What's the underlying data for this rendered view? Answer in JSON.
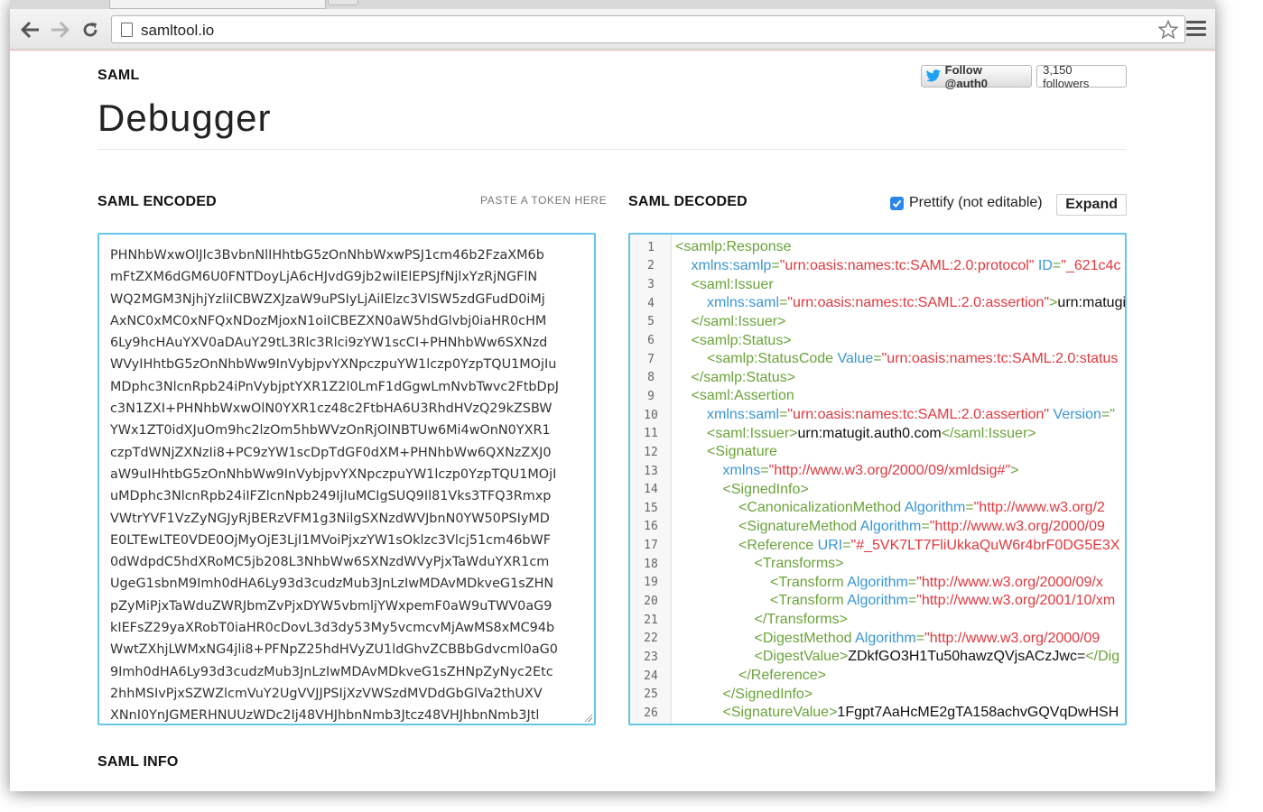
{
  "browser": {
    "url": "samltool.io"
  },
  "header": {
    "brand": "SAML",
    "title": "Debugger",
    "follow_label": "Follow @auth0",
    "followers": "3,150 followers"
  },
  "encoded": {
    "label": "SAML ENCODED",
    "hint": "PASTE A TOKEN HERE",
    "lines": [
      "PHNhbWxwOlJlc3BvbnNlIHhtbG5zOnNhbWxwPSJ1cm46b2FzaXM6b",
      "mFtZXM6dGM6U0FNTDoyLjA6cHJvdG9jb2wiIElEPSJfNjlxYzRjNGFlN",
      "WQ2MGM3NjhjYzliICBWZXJzaW9uPSIyLjAiIElzc3VlSW5zdGFudD0iMj",
      "AxNC0xMC0xNFQxNDozMjoxN1oiICBEZXN0aW5hdGlvbj0iaHR0cHM",
      "6Ly9hcHAuYXV0aDAuY29tL3Rlc3Rlci9zYW1scCI+PHNhbWw6SXNzd",
      "WVyIHhtbG5zOnNhbWw9InVybjpvYXNpczpuYW1lczp0YzpTQU1MOjIu",
      "MDphc3NlcnRpb24iPnVybjptYXR1Z2l0LmF1dGgwLmNvbTwvc2FtbDpJ",
      "c3N1ZXI+PHNhbWxwOlN0YXR1cz48c2FtbHA6U3RhdHVzQ29kZSBW",
      "YWx1ZT0idXJuOm9hc2lzOm5hbWVzOnRjOlNBTUw6Mi4wOnN0YXR1",
      "czpTdWNjZXNzIi8+PC9zYW1scDpTdGF0dXM+PHNhbWw6QXNzZXJ0",
      "aW9uIHhtbG5zOnNhbWw9InVybjpvYXNpczpuYW1lczp0YzpTQU1MOjI",
      "uMDphc3NlcnRpb24iIFZlcnNpb249IjIuMCIgSUQ9Il81Vks3TFQ3Rmxp",
      "VWtrYVF1VzZyNGJyRjBERzVFM1g3NilgSXNzdWVJbnN0YW50PSIyMD",
      "E0LTEwLTE0VDE0OjMyOjE3LjI1MVoiPjxzYW1sOklzc3Vlcj51cm46bWF",
      "0dWdpdC5hdXRoMC5jb208L3NhbWw6SXNzdWVyPjxTaWduYXR1cm",
      "UgeG1sbnM9Imh0dHA6Ly93d3cudzMub3JnLzIwMDAvMDkveG1sZHN",
      "pZyMiPjxTaWduZWRJbmZvPjxDYW5vbmljYWxpemF0aW9uTWV0aG9",
      "kIEFsZ29yaXRobT0iaHR0cDovL3d3dy53My5vcmcvMjAwMS8xMC94b",
      "WwtZXhjLWMxNG4jli8+PFNpZ25hdHVyZU1ldGhvZCBBbGdvcml0aG0",
      "9Imh0dHA6Ly93d3cudzMub3JnLzIwMDAvMDkveG1sZHNpZyNyc2Etc",
      "2hhMSIvPjxSZWZlcmVuY2UgVVJJPSIjXzVWSzdMVDdGbGlVa2thUXV",
      "XNnI0YnJGMERHNUUzWDc2Ij48VHJhbnNmb3Jtcz48VHJhbnNmb3Jtl"
    ]
  },
  "decoded": {
    "label": "SAML DECODED",
    "prettify_label": "Prettify (not editable)",
    "prettify_checked": true,
    "expand_label": "Expand",
    "lines": [
      {
        "n": "1",
        "indent": 0,
        "parts": [
          [
            "tag",
            "<samlp:Response"
          ]
        ]
      },
      {
        "n": "2",
        "indent": 1,
        "parts": [
          [
            "attr",
            "xmlns:samlp"
          ],
          [
            "tag",
            "="
          ],
          [
            "val",
            "\"urn:oasis:names:tc:SAML:2.0:protocol\""
          ],
          [
            "attr",
            " ID"
          ],
          [
            "tag",
            "="
          ],
          [
            "val",
            "\"_621c4c"
          ]
        ]
      },
      {
        "n": "3",
        "indent": 1,
        "parts": [
          [
            "tag",
            "<saml:Issuer"
          ]
        ]
      },
      {
        "n": "4",
        "indent": 2,
        "parts": [
          [
            "attr",
            "xmlns:saml"
          ],
          [
            "tag",
            "="
          ],
          [
            "val",
            "\"urn:oasis:names:tc:SAML:2.0:assertion\""
          ],
          [
            "tag",
            ">"
          ],
          [
            "txt",
            "urn:matugit"
          ]
        ]
      },
      {
        "n": "5",
        "indent": 1,
        "parts": [
          [
            "tag",
            "</saml:Issuer>"
          ]
        ]
      },
      {
        "n": "6",
        "indent": 1,
        "parts": [
          [
            "tag",
            "<samlp:Status>"
          ]
        ]
      },
      {
        "n": "7",
        "indent": 2,
        "parts": [
          [
            "tag",
            "<samlp:StatusCode"
          ],
          [
            "attr",
            " Value"
          ],
          [
            "tag",
            "="
          ],
          [
            "val",
            "\"urn:oasis:names:tc:SAML:2.0:status"
          ]
        ]
      },
      {
        "n": "8",
        "indent": 1,
        "parts": [
          [
            "tag",
            "</samlp:Status>"
          ]
        ]
      },
      {
        "n": "9",
        "indent": 1,
        "parts": [
          [
            "tag",
            "<saml:Assertion"
          ]
        ]
      },
      {
        "n": "10",
        "indent": 2,
        "parts": [
          [
            "attr",
            "xmlns:saml"
          ],
          [
            "tag",
            "="
          ],
          [
            "val",
            "\"urn:oasis:names:tc:SAML:2.0:assertion\""
          ],
          [
            "attr",
            " Version"
          ],
          [
            "tag",
            "=\""
          ]
        ]
      },
      {
        "n": "11",
        "indent": 2,
        "parts": [
          [
            "tag",
            "<saml:Issuer>"
          ],
          [
            "txt",
            "urn:matugit.auth0.com"
          ],
          [
            "tag",
            "</saml:Issuer>"
          ]
        ]
      },
      {
        "n": "12",
        "indent": 2,
        "parts": [
          [
            "tag",
            "<Signature"
          ]
        ]
      },
      {
        "n": "13",
        "indent": 3,
        "parts": [
          [
            "attr",
            "xmlns"
          ],
          [
            "tag",
            "="
          ],
          [
            "val",
            "\"http://www.w3.org/2000/09/xmldsig#\""
          ],
          [
            "tag",
            ">"
          ]
        ]
      },
      {
        "n": "14",
        "indent": 3,
        "parts": [
          [
            "tag",
            "<SignedInfo>"
          ]
        ]
      },
      {
        "n": "15",
        "indent": 4,
        "parts": [
          [
            "tag",
            "<CanonicalizationMethod"
          ],
          [
            "attr",
            " Algorithm"
          ],
          [
            "tag",
            "="
          ],
          [
            "val",
            "\"http://www.w3.org/2"
          ]
        ]
      },
      {
        "n": "16",
        "indent": 4,
        "parts": [
          [
            "tag",
            "<SignatureMethod"
          ],
          [
            "attr",
            " Algorithm"
          ],
          [
            "tag",
            "="
          ],
          [
            "val",
            "\"http://www.w3.org/2000/09"
          ]
        ]
      },
      {
        "n": "17",
        "indent": 4,
        "parts": [
          [
            "tag",
            "<Reference"
          ],
          [
            "attr",
            " URI"
          ],
          [
            "tag",
            "="
          ],
          [
            "val",
            "\"#_5VK7LT7FliUkkaQuW6r4brF0DG5E3X"
          ]
        ]
      },
      {
        "n": "18",
        "indent": 5,
        "parts": [
          [
            "tag",
            "<Transforms>"
          ]
        ]
      },
      {
        "n": "19",
        "indent": 6,
        "parts": [
          [
            "tag",
            "<Transform"
          ],
          [
            "attr",
            " Algorithm"
          ],
          [
            "tag",
            "="
          ],
          [
            "val",
            "\"http://www.w3.org/2000/09/x"
          ]
        ]
      },
      {
        "n": "20",
        "indent": 6,
        "parts": [
          [
            "tag",
            "<Transform"
          ],
          [
            "attr",
            " Algorithm"
          ],
          [
            "tag",
            "="
          ],
          [
            "val",
            "\"http://www.w3.org/2001/10/xm"
          ]
        ]
      },
      {
        "n": "21",
        "indent": 5,
        "parts": [
          [
            "tag",
            "</Transforms>"
          ]
        ]
      },
      {
        "n": "22",
        "indent": 5,
        "parts": [
          [
            "tag",
            "<DigestMethod"
          ],
          [
            "attr",
            " Algorithm"
          ],
          [
            "tag",
            "="
          ],
          [
            "val",
            "\"http://www.w3.org/2000/09"
          ]
        ]
      },
      {
        "n": "23",
        "indent": 5,
        "parts": [
          [
            "tag",
            "<DigestValue>"
          ],
          [
            "txt",
            "ZDkfGO3H1Tu50hawzQVjsACzJwc="
          ],
          [
            "tag",
            "</Dig"
          ]
        ]
      },
      {
        "n": "24",
        "indent": 4,
        "parts": [
          [
            "tag",
            "</Reference>"
          ]
        ]
      },
      {
        "n": "25",
        "indent": 3,
        "parts": [
          [
            "tag",
            "</SignedInfo>"
          ]
        ]
      },
      {
        "n": "26",
        "indent": 3,
        "parts": [
          [
            "tag",
            "<SignatureValue>"
          ],
          [
            "txt",
            "1Fgpt7AaHcME2gTA158achvGQVqDwHSH"
          ]
        ]
      }
    ]
  },
  "info": {
    "label": "SAML INFO"
  },
  "colors": {
    "tag": "#6aa33a",
    "attr": "#3b95d1",
    "val": "#e0383e",
    "focus_border": "#66c6ea",
    "checkbox": "#2c86e8",
    "twitter": "#1da1f2"
  },
  "icons": [
    "back-arrow-icon",
    "forward-arrow-icon",
    "reload-icon",
    "page-icon",
    "star-icon",
    "menu-icon",
    "twitter-bird-icon",
    "checkmark-icon"
  ]
}
